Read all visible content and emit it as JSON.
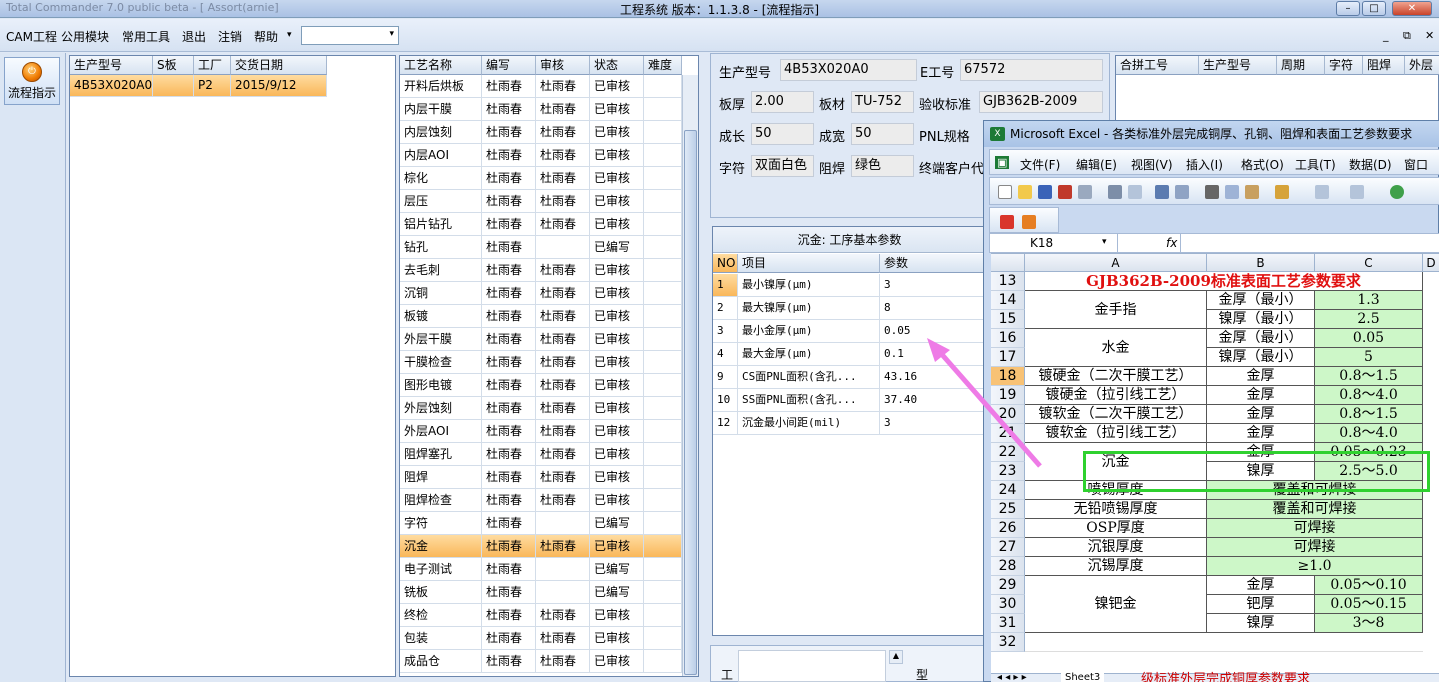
{
  "window": {
    "title": "工程系统  版本：1.1.3.8 - [流程指示]",
    "faded_title": "Total Commander 7.0 public beta - [  Assort(arnie]"
  },
  "menubar": {
    "items": [
      "CAM工程",
      "公用模块",
      "常用工具",
      "退出",
      "注销",
      "帮助"
    ],
    "dropdown_arrow": "▾"
  },
  "toolbar": {
    "flow_label": "流程指示"
  },
  "orders": {
    "headers": [
      "生产型号",
      "S板",
      "工厂",
      "交货日期"
    ],
    "rows": [
      [
        "4B53X020A0",
        "",
        "P2",
        "2015/9/12"
      ]
    ]
  },
  "processes": {
    "headers": [
      "工艺名称",
      "编写",
      "审核",
      "状态",
      "难度"
    ],
    "selected_index": 20,
    "rows": [
      [
        "开料后烘板",
        "杜雨春",
        "杜雨春",
        "已审核"
      ],
      [
        "内层干膜",
        "杜雨春",
        "杜雨春",
        "已审核"
      ],
      [
        "内层蚀刻",
        "杜雨春",
        "杜雨春",
        "已审核"
      ],
      [
        "内层AOI",
        "杜雨春",
        "杜雨春",
        "已审核"
      ],
      [
        "棕化",
        "杜雨春",
        "杜雨春",
        "已审核"
      ],
      [
        "层压",
        "杜雨春",
        "杜雨春",
        "已审核"
      ],
      [
        "铝片钻孔",
        "杜雨春",
        "杜雨春",
        "已审核"
      ],
      [
        "钻孔",
        "杜雨春",
        "",
        "已编写"
      ],
      [
        "去毛刺",
        "杜雨春",
        "杜雨春",
        "已审核"
      ],
      [
        "沉铜",
        "杜雨春",
        "杜雨春",
        "已审核"
      ],
      [
        "板镀",
        "杜雨春",
        "杜雨春",
        "已审核"
      ],
      [
        "外层干膜",
        "杜雨春",
        "杜雨春",
        "已审核"
      ],
      [
        "干膜检查",
        "杜雨春",
        "杜雨春",
        "已审核"
      ],
      [
        "图形电镀",
        "杜雨春",
        "杜雨春",
        "已审核"
      ],
      [
        "外层蚀刻",
        "杜雨春",
        "杜雨春",
        "已审核"
      ],
      [
        "外层AOI",
        "杜雨春",
        "杜雨春",
        "已审核"
      ],
      [
        "阻焊塞孔",
        "杜雨春",
        "杜雨春",
        "已审核"
      ],
      [
        "阻焊",
        "杜雨春",
        "杜雨春",
        "已审核"
      ],
      [
        "阻焊检查",
        "杜雨春",
        "杜雨春",
        "已审核"
      ],
      [
        "字符",
        "杜雨春",
        "",
        "已编写"
      ],
      [
        "沉金",
        "杜雨春",
        "杜雨春",
        "已审核"
      ],
      [
        "电子测试",
        "杜雨春",
        "",
        "已编写"
      ],
      [
        "铣板",
        "杜雨春",
        "",
        "已编写"
      ],
      [
        "终检",
        "杜雨春",
        "杜雨春",
        "已审核"
      ],
      [
        "包装",
        "杜雨春",
        "杜雨春",
        "已审核"
      ],
      [
        "成品仓",
        "杜雨春",
        "杜雨春",
        "已审核"
      ]
    ]
  },
  "form": {
    "model_label": "生产型号",
    "model": "4B53X020A0",
    "eno_label": "E工号",
    "eno": "67572",
    "thick_label": "板厚",
    "thick": "2.00",
    "mat_label": "板材",
    "mat": "TU-752",
    "std_label": "验收标准",
    "std": "GJB362B-2009",
    "len_label": "成长",
    "len": "50",
    "wid_label": "成宽",
    "wid": "50",
    "pnl_label": "PNL规格",
    "char_label": "字符",
    "char": "双面白色",
    "mask_label": "阻焊",
    "mask": "绿色",
    "cust_label": "终端客户代"
  },
  "merge": {
    "headers": [
      "合拼工号",
      "生产型号",
      "周期",
      "字符",
      "阻焊",
      "外层"
    ]
  },
  "params": {
    "title": "沉金: 工序基本参数",
    "headers": [
      "NO",
      "项目",
      "参数"
    ],
    "rows": [
      [
        "1",
        "最小镍厚(μm)",
        "3"
      ],
      [
        "2",
        "最大镍厚(μm)",
        "8"
      ],
      [
        "3",
        "最小金厚(μm)",
        "0.05"
      ],
      [
        "4",
        "最大金厚(μm)",
        "0.1"
      ],
      [
        "9",
        "CS面PNL面积(含孔...",
        "43.16"
      ],
      [
        "10",
        "SS面PNL面积(含孔...",
        "37.40"
      ],
      [
        "12",
        "沉金最小间距(mil)",
        "3"
      ]
    ]
  },
  "bottom": {
    "left": "工",
    "right": "型"
  },
  "excel": {
    "title": "Microsoft Excel - 各类标准外层完成铜厚、孔铜、阻焊和表面工艺参数要求",
    "menu": [
      "文件(F)",
      "编辑(E)",
      "视图(V)",
      "插入(I)",
      "格式(O)",
      "工具(T)",
      "数据(D)",
      "窗口"
    ],
    "namebox": "K18",
    "fx": "fx",
    "cols": [
      "A",
      "B",
      "C",
      "D"
    ],
    "rows": [
      "13",
      "14",
      "15",
      "16",
      "17",
      "18",
      "19",
      "20",
      "21",
      "22",
      "23",
      "24",
      "25",
      "26",
      "27",
      "28",
      "29",
      "30",
      "31",
      "32"
    ],
    "header_text": "GJB362B-2009标准表面工艺参数要求",
    "gold_finger": "金手指",
    "gold_min": "金厚（最小）",
    "gold_min_v": "1.3",
    "ni_min": "镍厚（最小）",
    "ni_min_v": "2.5",
    "water_gold": "水金",
    "wg_gold": "金厚（最小）",
    "wg_gold_v": "0.05",
    "wg_ni": "镍厚（最小）",
    "wg_ni_v": "5",
    "hard1": "镀硬金（二次干膜工艺）",
    "hard2": "镀硬金（拉引线工艺）",
    "soft1": "镀软金（二次干膜工艺）",
    "soft2": "镀软金（拉引线工艺）",
    "gold_thick": "金厚",
    "r18": "0.8～1.5",
    "r19": "0.8～4.0",
    "r20": "0.8～1.5",
    "r21": "0.8～4.0",
    "enig": "沉金",
    "enig_gold": "金厚",
    "enig_gold_v": "0.05～0.23",
    "enig_ni": "镍厚",
    "enig_ni_v": "2.5～5.0",
    "hasl": "喷锡厚度",
    "hasl_v": "覆盖和可焊接",
    "lf": "无铅喷锡厚度",
    "lf_v": "覆盖和可焊接",
    "osp": "OSP厚度",
    "osp_v": "可焊接",
    "silver": "沉银厚度",
    "silver_v": "可焊接",
    "tin": "沉锡厚度",
    "tin_v": "≥1.0",
    "nipd": "镍钯金",
    "np_gold": "金厚",
    "np_gold_v": "0.05～0.10",
    "np_pd": "钯厚",
    "np_pd_v": "0.05～0.15",
    "np_ni": "镍厚",
    "np_ni_v": "3～8",
    "sheet": "Sheet3",
    "partial": "级标准外层完成铜厚参数要求"
  }
}
